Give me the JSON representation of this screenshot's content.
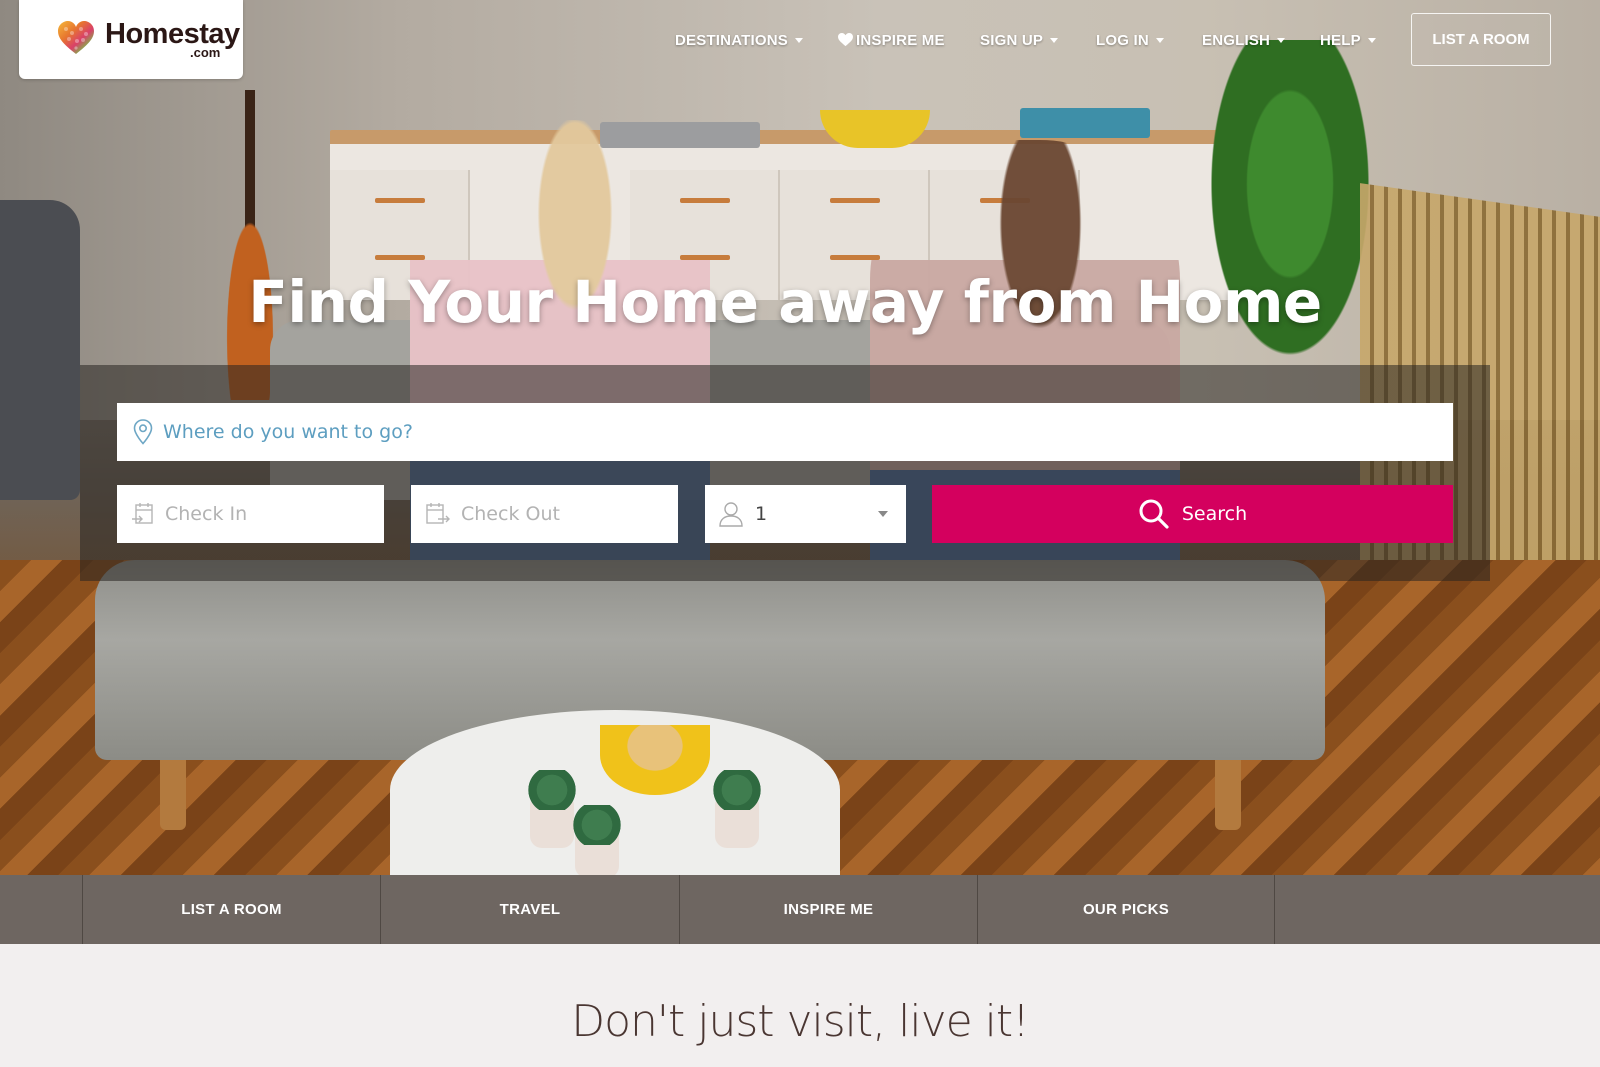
{
  "brand": {
    "name": "Homestay",
    "suffix": ".com",
    "colors": {
      "accent": "#d4005e",
      "tabbar": "#6e6661",
      "placeholder_blue": "#5d9ec0",
      "tagline": "#4a3632"
    }
  },
  "header": {
    "nav": [
      {
        "label": "DESTINATIONS",
        "icon": "caret-down-icon",
        "has_dropdown": true
      },
      {
        "label": "INSPIRE ME",
        "icon": "heart-icon",
        "has_dropdown": false
      },
      {
        "label": "SIGN UP",
        "icon": "caret-down-icon",
        "has_dropdown": true
      },
      {
        "label": "LOG IN",
        "icon": "caret-down-icon",
        "has_dropdown": true
      },
      {
        "label": "ENGLISH",
        "icon": "caret-down-icon",
        "has_dropdown": true
      },
      {
        "label": "HELP",
        "icon": "caret-down-icon",
        "has_dropdown": true
      }
    ],
    "cta_label": "LIST A ROOM"
  },
  "hero": {
    "headline": "Find Your Home away from Home",
    "search": {
      "destination_placeholder": "Where do you want to go?",
      "destination_icon": "map-pin-icon",
      "checkin_placeholder": "Check In",
      "checkin_icon": "calendar-in-icon",
      "checkout_placeholder": "Check Out",
      "checkout_icon": "calendar-out-icon",
      "guests_value": "1",
      "guests_icon": "person-icon",
      "submit_label": "Search",
      "submit_icon": "search-icon"
    }
  },
  "tabs": [
    {
      "label": ""
    },
    {
      "label": "LIST A ROOM"
    },
    {
      "label": "TRAVEL"
    },
    {
      "label": "INSPIRE ME"
    },
    {
      "label": "OUR PICKS"
    },
    {
      "label": ""
    }
  ],
  "tagline": "Don't just visit, live it!"
}
